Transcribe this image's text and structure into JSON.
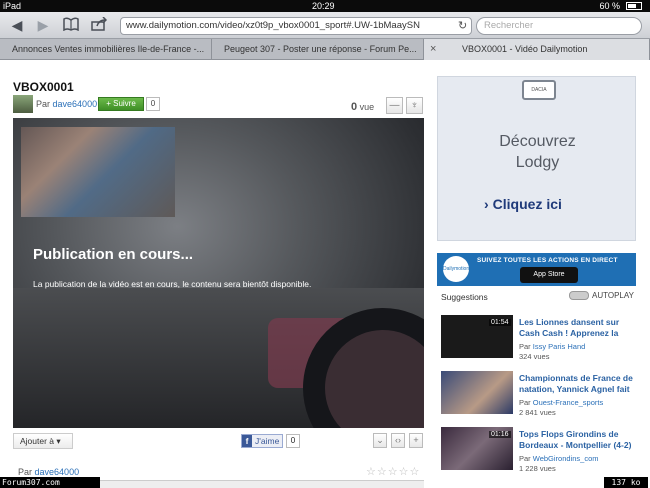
{
  "status": {
    "device": "iPad",
    "time": "20:29",
    "battery": "60 %"
  },
  "toolbar": {
    "url": "www.dailymotion.com/video/xz0t9p_vbox0001_sport#.UW-1bMaaySN",
    "search_placeholder": "Rechercher"
  },
  "tabs": [
    {
      "label": "Annonces Ventes immobilières Ile-de-France -..."
    },
    {
      "label": "Peugeot 307 - Poster une réponse - Forum Pe..."
    },
    {
      "label": "VBOX0001 - Vidéo Dailymotion"
    }
  ],
  "video": {
    "title": "VBOX0001",
    "by_label": "Par",
    "author": "dave64000",
    "follow_label": "Suivre",
    "follow_count": "0",
    "views_count": "0",
    "views_label": "vue",
    "publishing_title": "Publication en cours...",
    "publishing_text": "La publication de la vidéo est en cours, le contenu sera bientôt disponible.",
    "add_to_label": "Ajouter à",
    "like_label": "J'aime",
    "like_count": "0"
  },
  "details": {
    "by_label": "Par",
    "author": "dave64000"
  },
  "ad": {
    "brand": "DACIA",
    "line1": "Découvrez",
    "line2": "Lodgy",
    "cta": "Cliquez ici"
  },
  "live_banner": {
    "text": "SUIVEZ TOUTES LES ACTIONS EN DIRECT",
    "brand": "Dailymotion",
    "store": "App Store"
  },
  "suggestions": {
    "heading": "Suggestions",
    "autoplay": "AUTOPLAY",
    "items": [
      {
        "title": "Les Lionnes dansent sur Cash Cash ! Apprenez la",
        "by": "Par",
        "author": "Issy Paris Hand",
        "views": "324 vues",
        "duration": "01:54"
      },
      {
        "title": "Championnats de France de natation, Yannick Agnel fait",
        "by": "Par",
        "author": "Ouest-France_sports",
        "views": "2 841 vues",
        "duration": ""
      },
      {
        "title": "Tops Flops Girondins de Bordeaux - Montpellier (4-2)",
        "by": "Par",
        "author": "WebGirondins_com",
        "views": "1 228 vues",
        "duration": "01:16"
      }
    ]
  },
  "overlay": {
    "forum": "Forum307.com",
    "size": "137 ko"
  },
  "colors": {
    "accent_blue": "#2b70b8",
    "follow_green": "#4fa233",
    "live_blue": "#1f6fb4"
  }
}
